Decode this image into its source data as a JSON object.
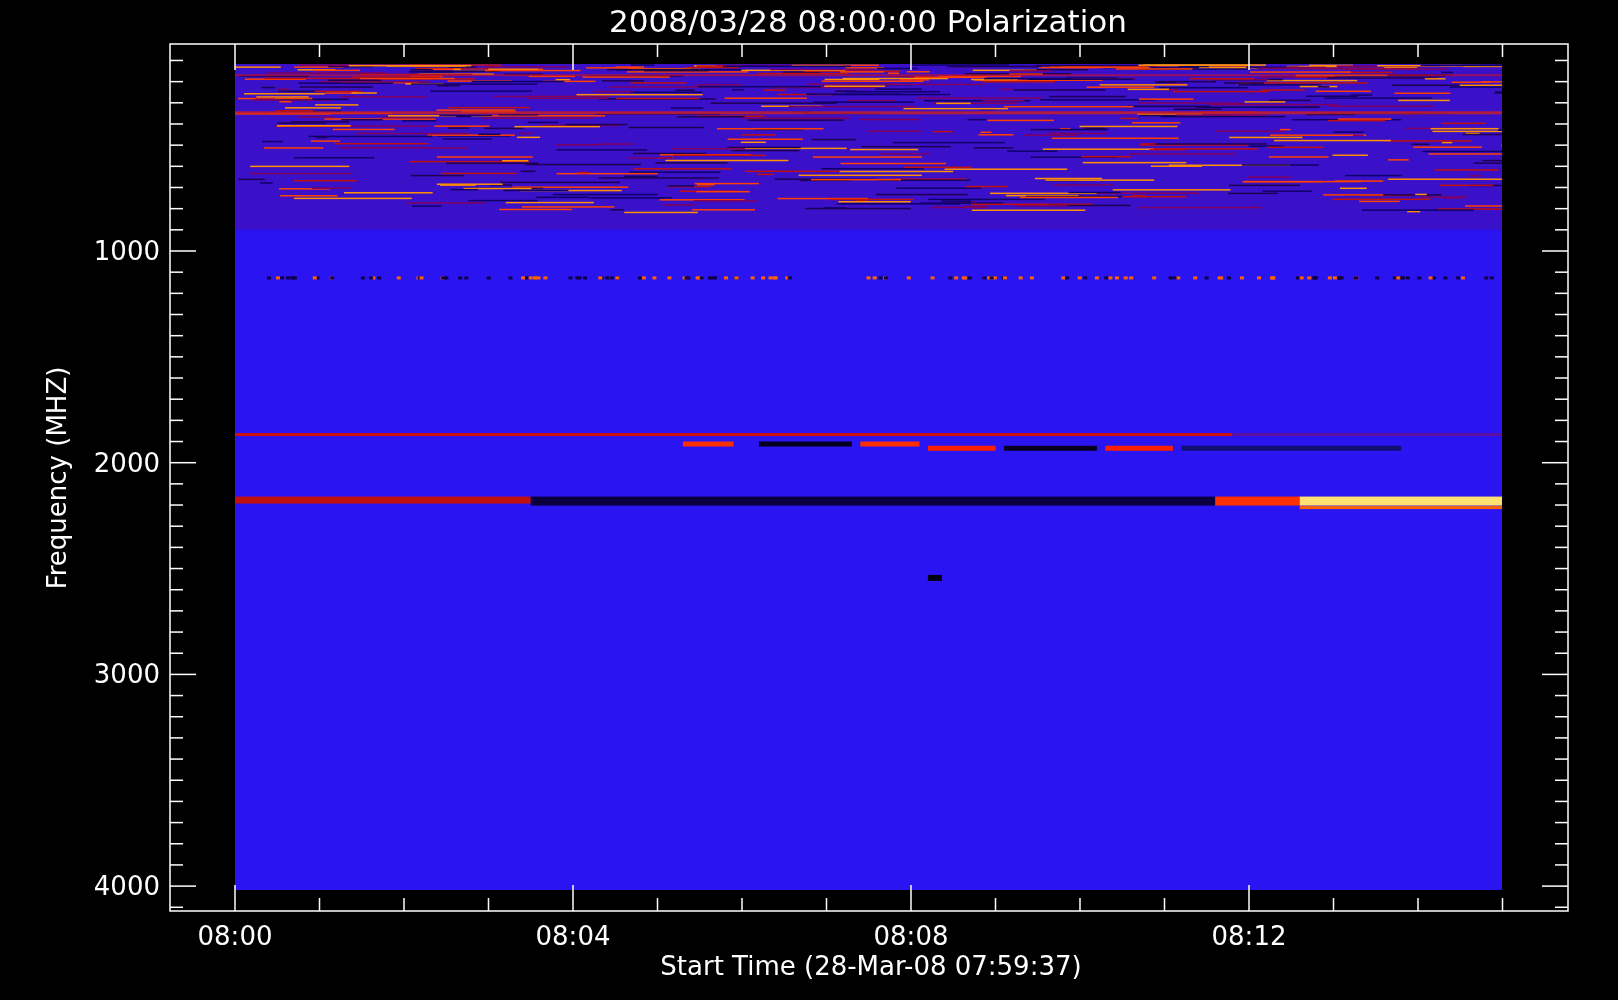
{
  "title": "2008/03/28 08:00:00 Polarization",
  "plot": {
    "xlabel": "Start Time (28-Mar-08 07:59:37)",
    "ylabel": "Frequency (MHZ)",
    "xticks": [
      {
        "label": "08:00"
      },
      {
        "label": "08:04"
      },
      {
        "label": "08:08"
      },
      {
        "label": "08:12"
      }
    ],
    "yticks": [
      {
        "label": "1000"
      },
      {
        "label": "2000"
      },
      {
        "label": "3000"
      },
      {
        "label": "4000"
      }
    ]
  }
}
